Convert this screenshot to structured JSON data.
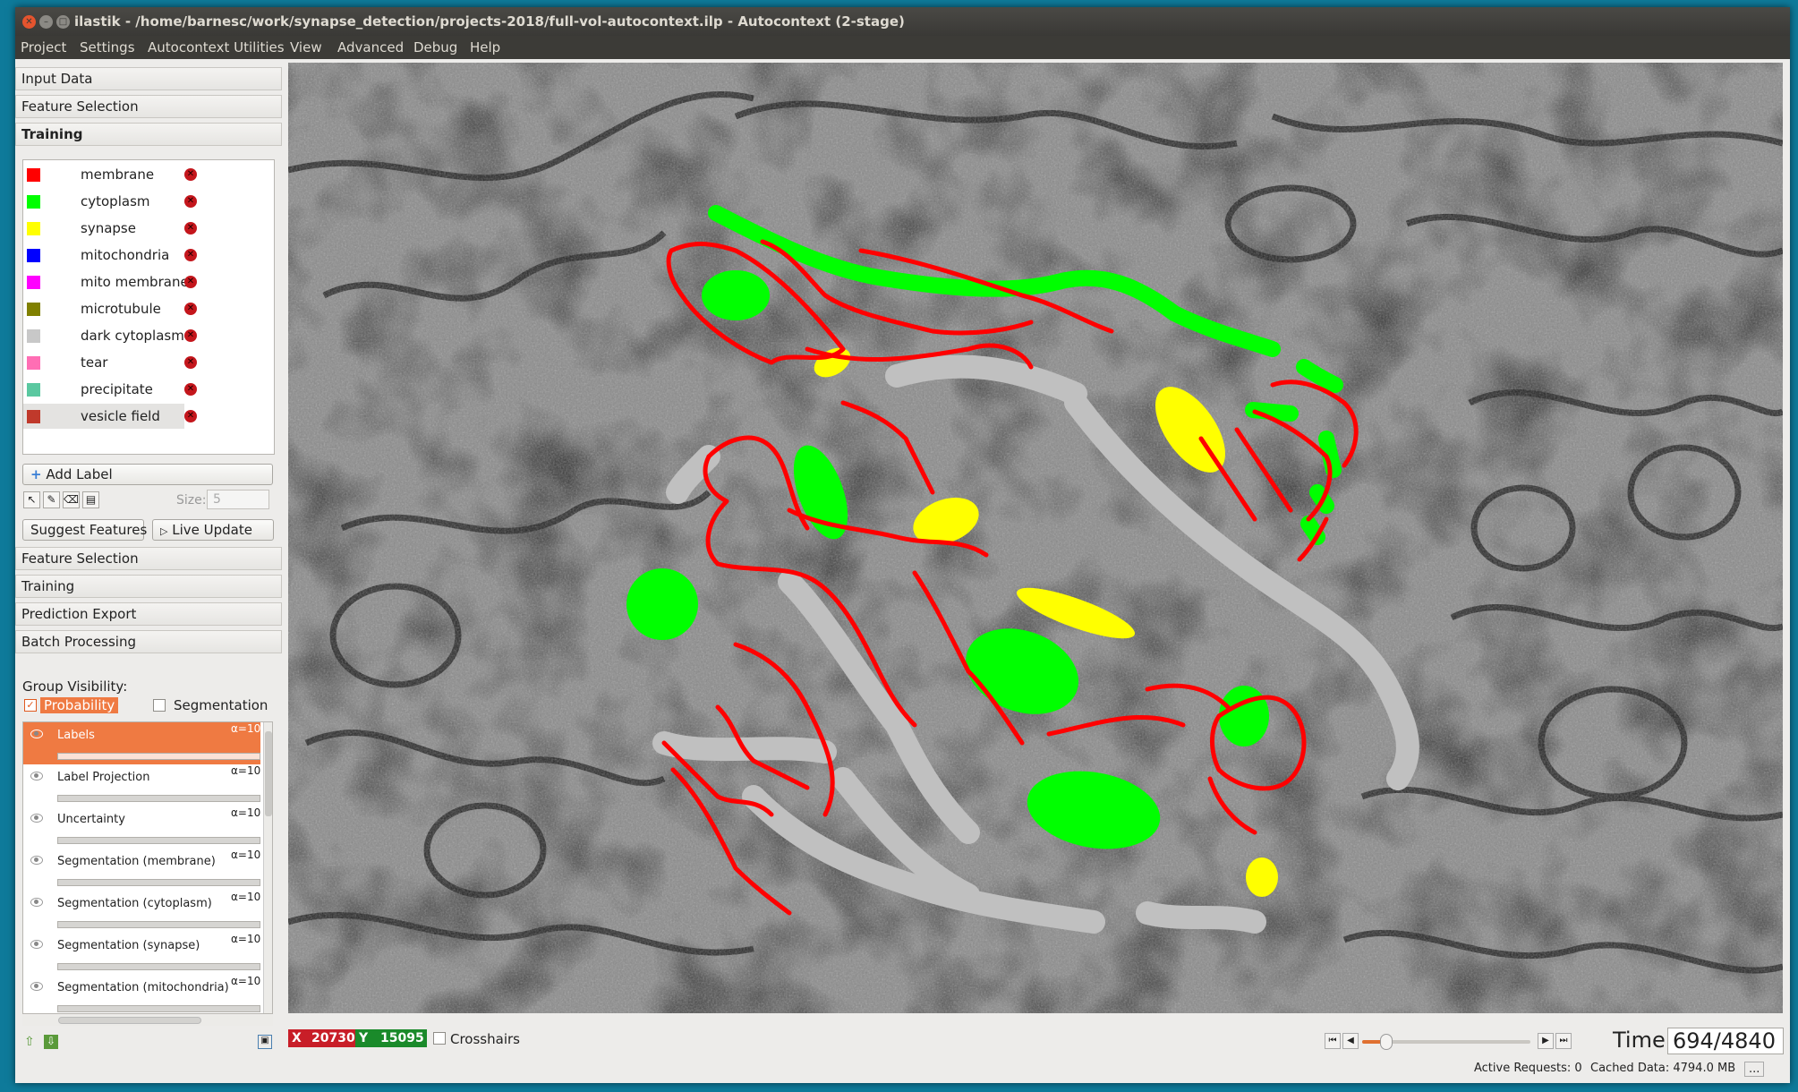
{
  "window": {
    "title": "ilastik - /home/barnesc/work/synapse_detection/projects-2018/full-vol-autocontext.ilp - Autocontext (2-stage)"
  },
  "menu": [
    {
      "label": "Project"
    },
    {
      "label": "Settings"
    },
    {
      "label": "Autocontext Utilities"
    },
    {
      "label": "View"
    },
    {
      "label": "Advanced"
    },
    {
      "label": "Debug"
    },
    {
      "label": "Help"
    }
  ],
  "applets_top": [
    "Input Data",
    "Feature Selection",
    "Training"
  ],
  "labels": [
    {
      "name": "membrane",
      "color": "#ff0000"
    },
    {
      "name": "cytoplasm",
      "color": "#00ff00"
    },
    {
      "name": "synapse",
      "color": "#ffff00"
    },
    {
      "name": "mitochondria",
      "color": "#0000ff"
    },
    {
      "name": "mito membrane",
      "color": "#ff00ff"
    },
    {
      "name": "microtubule",
      "color": "#808000"
    },
    {
      "name": "dark cytoplasm",
      "color": "#c8c8c8"
    },
    {
      "name": "tear",
      "color": "#ff6eb4"
    },
    {
      "name": "precipitate",
      "color": "#5ac8a0"
    },
    {
      "name": "vesicle field",
      "color": "#c0392b"
    }
  ],
  "training_controls": {
    "add_label": "Add Label",
    "size_label": "Size:",
    "size_value": "5",
    "suggest_features": "Suggest Features",
    "live_update": "Live Update"
  },
  "applets_bottom": [
    "Feature Selection",
    "Training",
    "Prediction Export",
    "Batch Processing"
  ],
  "group_visibility": {
    "title": "Group Visibility:",
    "probability": {
      "label": "Probability",
      "checked": true
    },
    "segmentation": {
      "label": "Segmentation",
      "checked": false
    }
  },
  "layers": [
    {
      "name": "Labels",
      "alpha": "α=10"
    },
    {
      "name": "Label Projection",
      "alpha": "α=10"
    },
    {
      "name": "Uncertainty",
      "alpha": "α=10"
    },
    {
      "name": "Segmentation (membrane)",
      "alpha": "α=10"
    },
    {
      "name": "Segmentation (cytoplasm)",
      "alpha": "α=10"
    },
    {
      "name": "Segmentation (synapse)",
      "alpha": "α=10"
    },
    {
      "name": "Segmentation (mitochondria)",
      "alpha": "α=10"
    }
  ],
  "coords": {
    "x_label": "X",
    "x_value": "20730",
    "y_label": "Y",
    "y_value": "15095"
  },
  "crosshairs": {
    "label": "Crosshairs",
    "checked": false
  },
  "time": {
    "label": "Time:",
    "value": "694/4840",
    "slider_fraction": 0.143
  },
  "status": {
    "active_requests": "Active Requests: 0",
    "cached_data": "Cached Data: 4794.0 MB",
    "more": "..."
  },
  "colors": {
    "accent": "#ef7a42",
    "x_badge": "#c81e28",
    "y_badge": "#1a8a2a",
    "titlebar": "#3c3b37"
  }
}
